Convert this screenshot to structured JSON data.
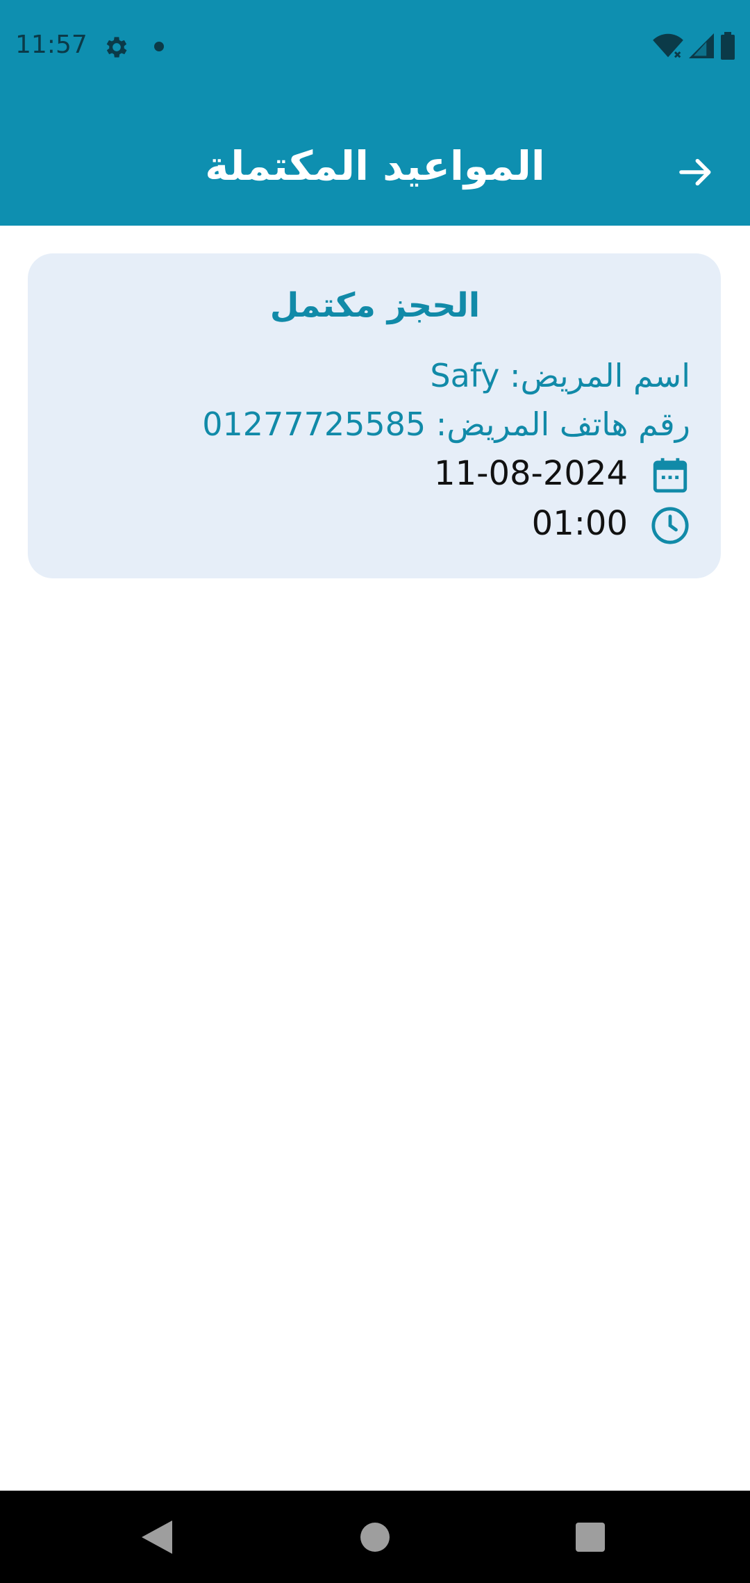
{
  "status_bar": {
    "time": "11:57"
  },
  "toolbar": {
    "title": "المواعيد المكتملة"
  },
  "appointment": {
    "title": "الحجز مكتمل",
    "patient_name": "اسم المريض: Safy",
    "patient_phone": "رقم هاتف المريض: 01277725585",
    "date": "11-08-2024",
    "time": "01:00"
  },
  "colors": {
    "primary": "#0e8fb0",
    "card_background": "#e6eef8",
    "accent_text": "#118aa8"
  },
  "icons": {
    "status": [
      "gear-icon",
      "wifi-icon",
      "signal-icon",
      "battery-icon"
    ],
    "toolbar": "arrow-forward-icon",
    "card": [
      "calendar-icon",
      "clock-icon"
    ],
    "navigation": [
      "nav-back-icon",
      "nav-home-icon",
      "nav-recents-icon"
    ]
  }
}
